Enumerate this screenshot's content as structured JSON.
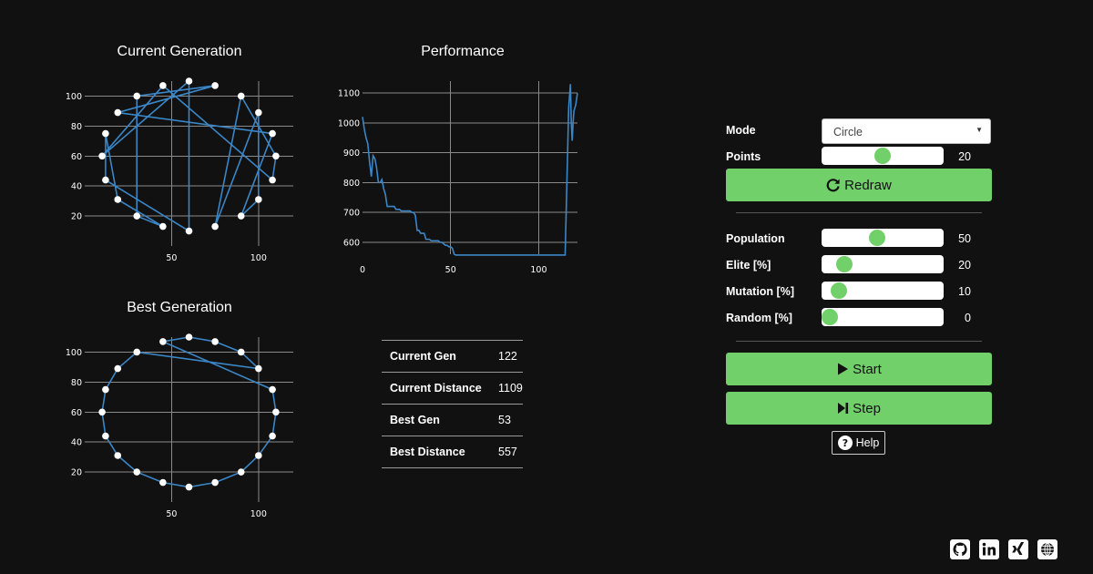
{
  "charts": {
    "current_title": "Current Generation",
    "performance_title": "Performance",
    "best_title": "Best Generation"
  },
  "chart_data": [
    {
      "type": "scatter",
      "title": "Current Generation",
      "xlim": [
        0,
        120
      ],
      "ylim": [
        0,
        110
      ],
      "x_ticks": [
        50,
        100
      ],
      "y_ticks": [
        20,
        40,
        60,
        80,
        100
      ],
      "grid": true,
      "points": [
        [
          60,
          110
        ],
        [
          75,
          107
        ],
        [
          90,
          100
        ],
        [
          100,
          89
        ],
        [
          108,
          75
        ],
        [
          110,
          60
        ],
        [
          108,
          44
        ],
        [
          100,
          31
        ],
        [
          90,
          20
        ],
        [
          75,
          13
        ],
        [
          60,
          10
        ],
        [
          45,
          13
        ],
        [
          30,
          20
        ],
        [
          19,
          31
        ],
        [
          12,
          44
        ],
        [
          10,
          60
        ],
        [
          12,
          75
        ],
        [
          19,
          89
        ],
        [
          30,
          100
        ],
        [
          45,
          107
        ]
      ],
      "tour": [
        0,
        10,
        14,
        16,
        13,
        11,
        12,
        18,
        1,
        17,
        4,
        8,
        7,
        3,
        9,
        2,
        5,
        6,
        19,
        15,
        0
      ]
    },
    {
      "type": "line",
      "title": "Performance",
      "xlim": [
        0,
        122
      ],
      "ylim": [
        560,
        1140
      ],
      "x_ticks": [
        0,
        50,
        100
      ],
      "y_ticks": [
        600,
        700,
        800,
        900,
        1000,
        1100
      ],
      "grid": true,
      "x": [
        0,
        1,
        2,
        3,
        4,
        5,
        6,
        7,
        8,
        9,
        10,
        11,
        12,
        13,
        14,
        15,
        16,
        17,
        18,
        19,
        20,
        21,
        22,
        23,
        24,
        25,
        26,
        27,
        28,
        29,
        30,
        31,
        32,
        33,
        34,
        35,
        36,
        37,
        38,
        39,
        40,
        41,
        42,
        43,
        44,
        45,
        46,
        47,
        48,
        49,
        50,
        51,
        52,
        53,
        60,
        70,
        80,
        90,
        100,
        110,
        115,
        116,
        117,
        118,
        118.5,
        119,
        119.5,
        120,
        121,
        122
      ],
      "y": [
        1020,
        980,
        950,
        930,
        870,
        820,
        890,
        880,
        850,
        800,
        800,
        810,
        780,
        760,
        720,
        720,
        720,
        720,
        720,
        710,
        710,
        710,
        705,
        705,
        705,
        705,
        705,
        705,
        700,
        700,
        690,
        640,
        640,
        630,
        630,
        630,
        610,
        610,
        610,
        605,
        605,
        605,
        605,
        605,
        600,
        600,
        595,
        590,
        590,
        585,
        585,
        580,
        560,
        557,
        557,
        557,
        557,
        557,
        557,
        557,
        557,
        800,
        1050,
        1130,
        1000,
        940,
        1000,
        1040,
        1060,
        1100
      ]
    },
    {
      "type": "scatter",
      "title": "Best Generation",
      "xlim": [
        0,
        120
      ],
      "ylim": [
        0,
        110
      ],
      "x_ticks": [
        50,
        100
      ],
      "y_ticks": [
        20,
        40,
        60,
        80,
        100
      ],
      "grid": true,
      "points": [
        [
          60,
          110
        ],
        [
          75,
          107
        ],
        [
          90,
          100
        ],
        [
          100,
          89
        ],
        [
          108,
          75
        ],
        [
          110,
          60
        ],
        [
          108,
          44
        ],
        [
          100,
          31
        ],
        [
          90,
          20
        ],
        [
          75,
          13
        ],
        [
          60,
          10
        ],
        [
          45,
          13
        ],
        [
          30,
          20
        ],
        [
          19,
          31
        ],
        [
          12,
          44
        ],
        [
          10,
          60
        ],
        [
          12,
          75
        ],
        [
          19,
          89
        ],
        [
          30,
          100
        ],
        [
          45,
          107
        ]
      ],
      "tour": [
        0,
        1,
        2,
        3,
        18,
        17,
        16,
        15,
        14,
        13,
        12,
        11,
        10,
        9,
        8,
        7,
        6,
        5,
        4,
        19,
        0
      ]
    }
  ],
  "stats": [
    {
      "label": "Current Gen",
      "value": "122"
    },
    {
      "label": "Current Distance",
      "value": "1109"
    },
    {
      "label": "Best Gen",
      "value": "53"
    },
    {
      "label": "Best Distance",
      "value": "557"
    }
  ],
  "controls": {
    "mode_label": "Mode",
    "mode_value": "Circle",
    "points_label": "Points",
    "points_value": "20",
    "points_fraction": 0.5,
    "redraw_label": "Redraw",
    "population_label": "Population",
    "population_value": "50",
    "population_fraction": 0.45,
    "elite_label": "Elite [%]",
    "elite_value": "20",
    "elite_fraction": 0.14,
    "mutation_label": "Mutation [%]",
    "mutation_value": "10",
    "mutation_fraction": 0.09,
    "random_label": "Random [%]",
    "random_value": "0",
    "random_fraction": 0.0,
    "start_label": "Start",
    "step_label": "Step",
    "help_label": "Help"
  },
  "social": {
    "icons": [
      "github-icon",
      "linkedin-icon",
      "xing-icon",
      "globe-icon"
    ]
  },
  "colors": {
    "accent": "#72d06a",
    "line": "#3b86c6",
    "background": "#111111"
  }
}
